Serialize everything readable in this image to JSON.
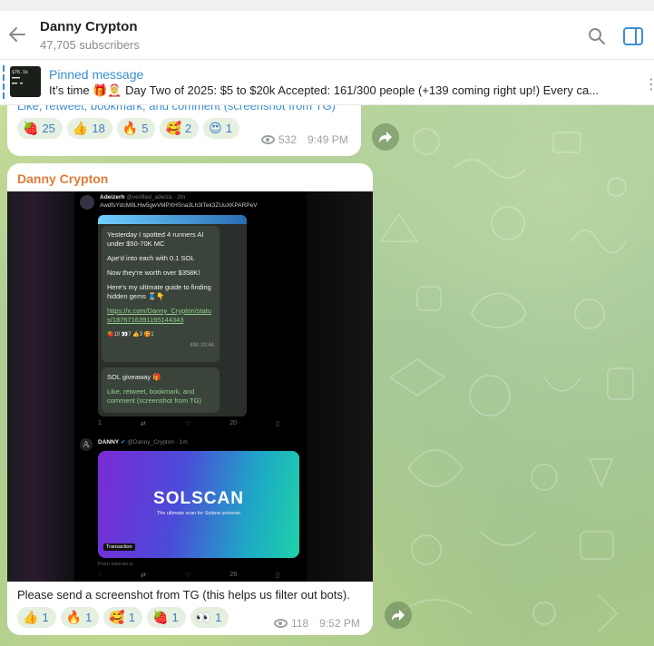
{
  "header": {
    "title": "Danny Crypton",
    "subtitle": "47,705 subscribers"
  },
  "pinned": {
    "label": "Pinned message",
    "text": "It’s time 🎁🤶  Day Two of 2025: $5 to $20k  Accepted: 161/300 people (+139 coming right up!)  Every ca...",
    "thumb_text": "$76.1k"
  },
  "messages": [
    {
      "caption": "Like, retweet, bookmark, and comment (screenshot from TG)",
      "reactions": [
        {
          "emoji": "🍓",
          "count": "25"
        },
        {
          "emoji": "👍",
          "count": "18"
        },
        {
          "emoji": "🔥",
          "count": "5"
        },
        {
          "emoji": "🥰",
          "count": "2"
        },
        {
          "emoji": "😍",
          "count": "1"
        }
      ],
      "views": "532",
      "time": "9:49 PM"
    },
    {
      "sender": "Danny Crypton",
      "caption": "Please send a screenshot from TG (this helps us filter out bots).",
      "reactions": [
        {
          "emoji": "👍",
          "count": "1"
        },
        {
          "emoji": "🔥",
          "count": "1"
        },
        {
          "emoji": "🥰",
          "count": "1"
        },
        {
          "emoji": "🍓",
          "count": "1"
        },
        {
          "emoji": "👀",
          "count": "1"
        }
      ],
      "views": "118",
      "time": "9:52 PM"
    }
  ],
  "embedded_screenshot": {
    "tweet1": {
      "author": "Adeizerh",
      "handle": "@verified_adeiza · 2m",
      "address": "AwdfsYdcM8LHw5gwVMPXHSna3Lh3tTek3ZUuXKPARPeV",
      "msg1": [
        "Yesterday I spotted 4 runners AI under $50-70K MC",
        "Ape'd into each with 0.1 SOL",
        "Now they're worth over $358K!",
        "Here's my ultimate guide to finding hidden gems 🧵👇"
      ],
      "link": "https://x.com/Danny_Crypton/status/1876716391195144343",
      "msg1_reacts": "🍓10  👀7  👍3  🥰1",
      "msg1_meta": "490  20:44",
      "msg2_title": "SOL giveaway 🎁",
      "msg2_body": "Like, retweet, bookmark, and comment (screenshot from TG)",
      "stats": [
        "1",
        "",
        "",
        "20",
        "",
        ""
      ]
    },
    "tweet2": {
      "author": "DANNY",
      "handle": "@Danny_Crypton · 1m",
      "banner_logo": "SOLSCAN",
      "banner_sub": "The ultimate scan for Solana universe",
      "banner_tag": "Transaction",
      "from": "From solscan.io",
      "stats": [
        "",
        "",
        "",
        "26",
        "",
        ""
      ]
    }
  },
  "colors": {
    "accent": "#3a8fd1",
    "sender": "#e07b39",
    "reaction_bg": "#e5f0e0",
    "reaction_text": "#3e7cc7"
  },
  "icons": {
    "back": "arrow-left-icon",
    "search": "search-icon",
    "panel": "sidebar-panel-icon",
    "share": "share-arrow-icon",
    "views": "eye-icon",
    "pin": "pin-list-icon"
  }
}
